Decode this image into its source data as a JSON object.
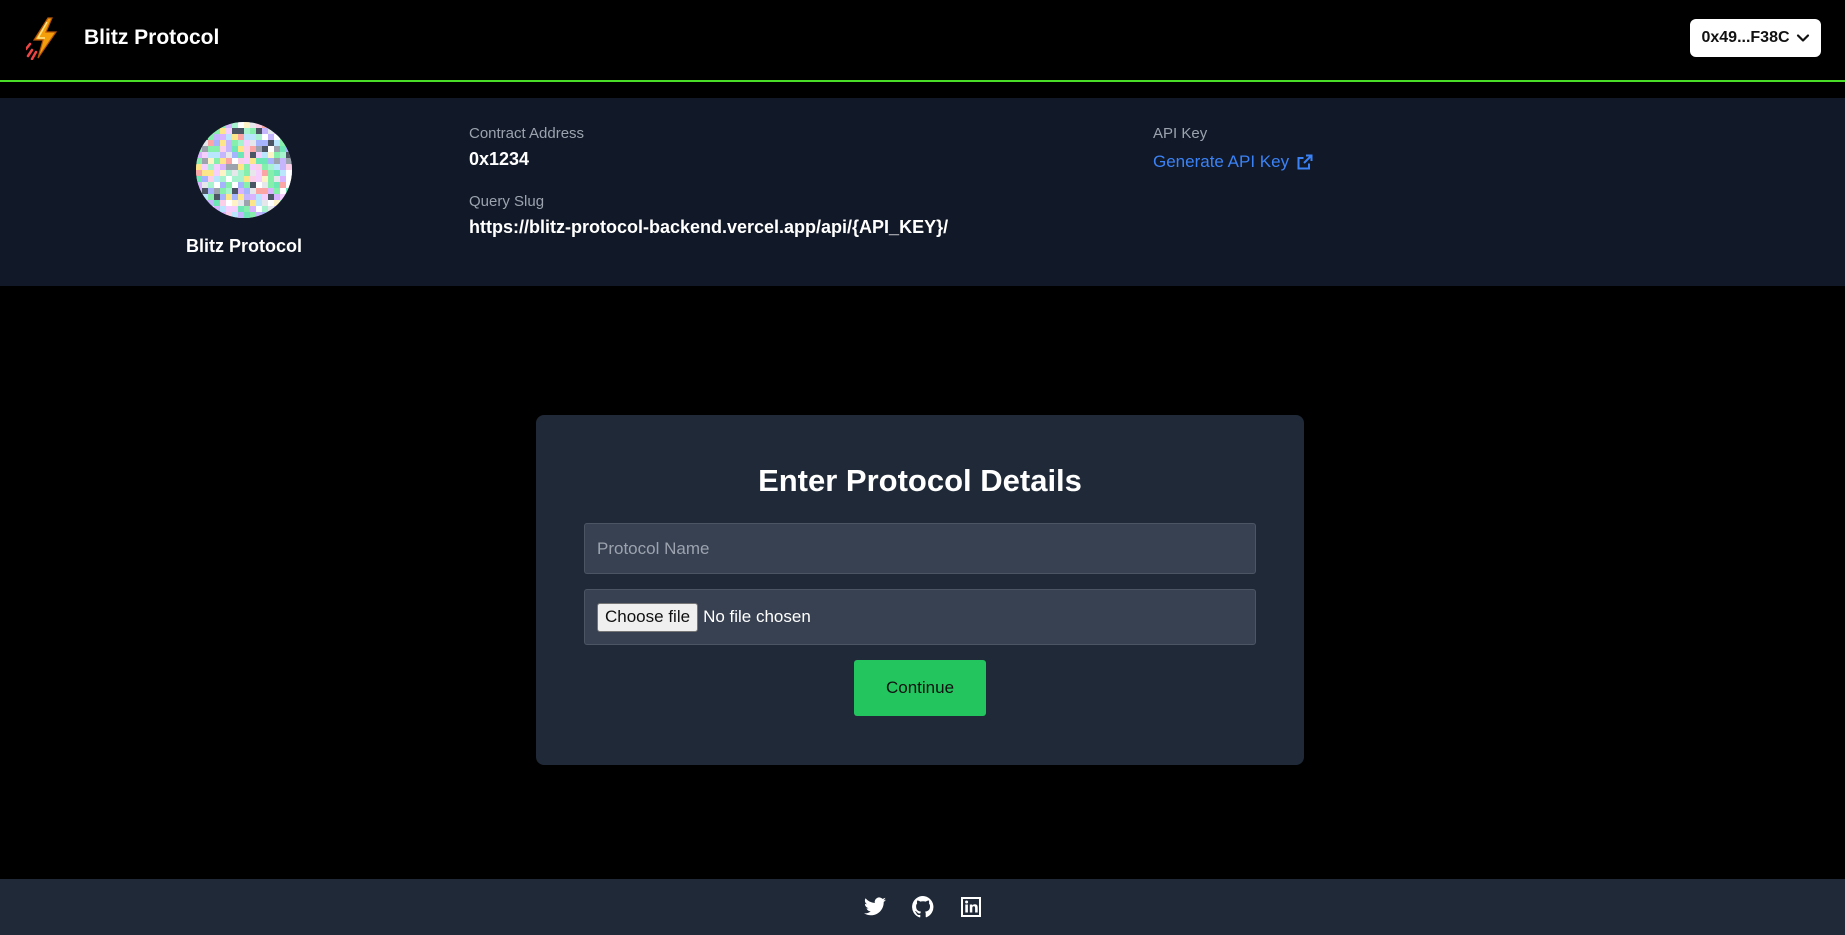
{
  "header": {
    "brand_name": "Blitz Protocol",
    "wallet_address": "0x49...F38C"
  },
  "profile": {
    "name": "Blitz Protocol",
    "contract_address_label": "Contract Address",
    "contract_address": "0x1234",
    "query_slug_label": "Query Slug",
    "query_slug": "https://blitz-protocol-backend.vercel.app/api/{API_KEY}/",
    "api_key_label": "API Key",
    "api_key_link": "Generate API Key"
  },
  "form": {
    "title": "Enter Protocol Details",
    "protocol_name_placeholder": "Protocol Name",
    "protocol_name_value": "",
    "file_button": "Choose file",
    "file_status": "No file chosen",
    "continue_label": "Continue"
  },
  "footer": {
    "icons": [
      "twitter-icon",
      "github-icon",
      "linkedin-icon"
    ]
  },
  "colors": {
    "accent_green": "#22c55e",
    "header_border": "#4ade29",
    "link_blue": "#3b82f6",
    "profile_bg": "#111827",
    "card_bg": "#1f2937"
  }
}
